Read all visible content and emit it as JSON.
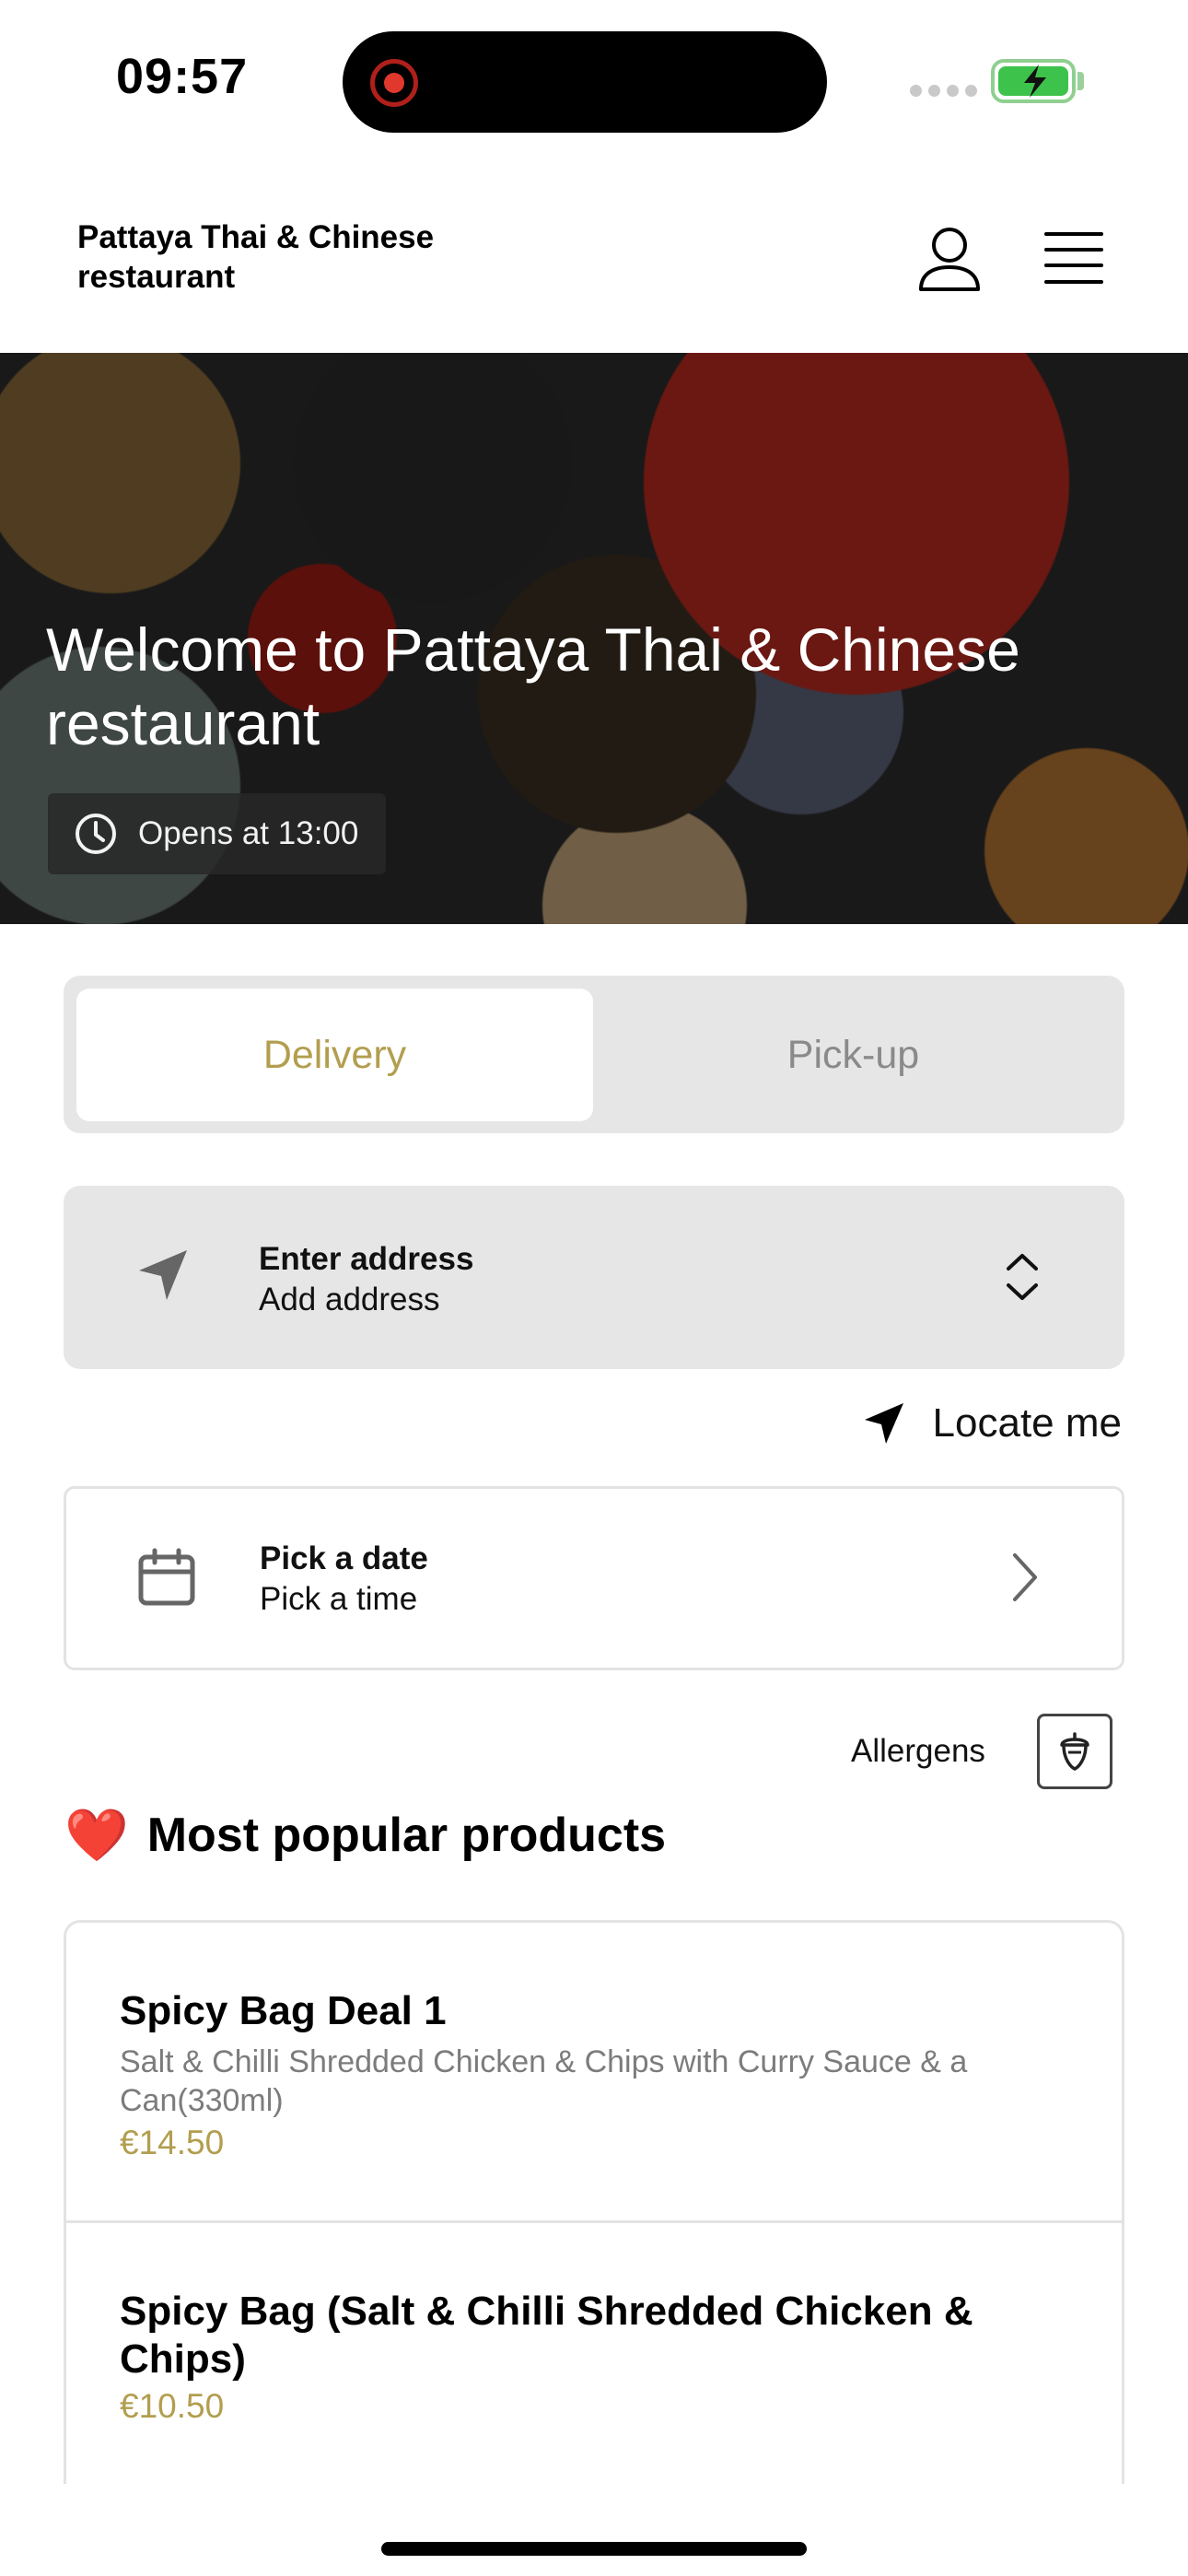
{
  "status_bar": {
    "time": "09:57"
  },
  "header": {
    "brand": "Pattaya Thai & Chinese restaurant"
  },
  "hero": {
    "title": "Welcome to Pattaya Thai & Chinese restaurant",
    "hours": "Opens at 13:00"
  },
  "order_mode": {
    "delivery_label": "Delivery",
    "pickup_label": "Pick-up",
    "selected": "Delivery"
  },
  "address": {
    "title": "Enter address",
    "subtitle": "Add address"
  },
  "locate": {
    "label": "Locate me"
  },
  "schedule": {
    "title": "Pick a date",
    "subtitle": "Pick a time"
  },
  "allergens": {
    "label": "Allergens"
  },
  "popular": {
    "heading": "Most popular products",
    "emoji": "❤️",
    "items": [
      {
        "name": "Spicy Bag Deal 1",
        "description": "Salt & Chilli Shredded Chicken & Chips with Curry Sauce & a Can(330ml)",
        "price": "€14.50"
      },
      {
        "name": "Spicy Bag (Salt & Chilli Shredded Chicken & Chips)",
        "price": "€10.50"
      }
    ]
  },
  "colors": {
    "accent": "#b29e4f",
    "panel": "#e6e6e6",
    "heart": "#e0282e",
    "battery": "#3dc24b"
  }
}
